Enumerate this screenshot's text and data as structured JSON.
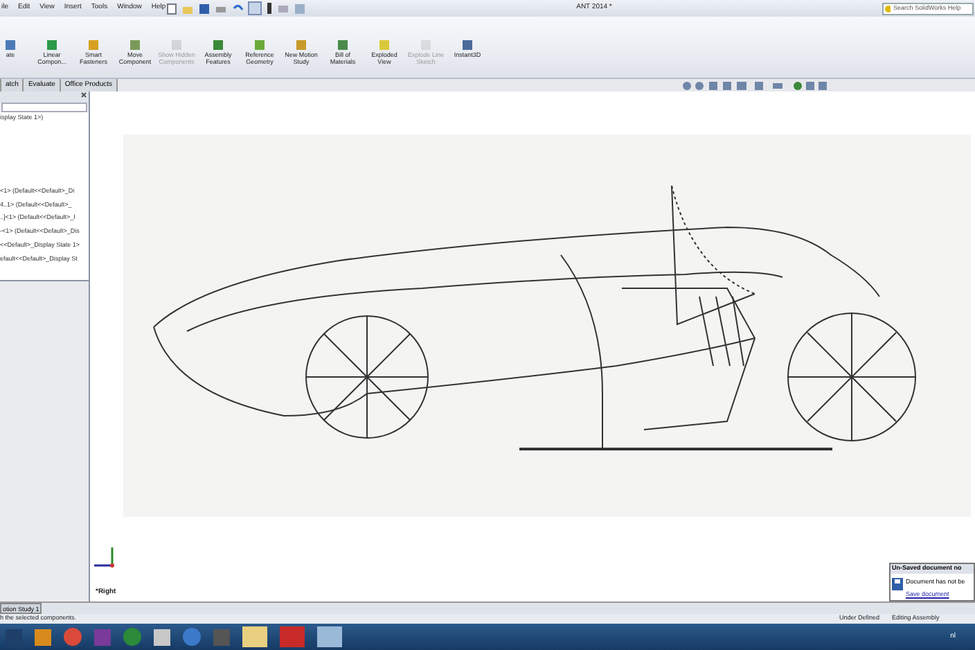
{
  "menu_bar": {
    "items": [
      "ile",
      "Edit",
      "View",
      "Insert",
      "Tools",
      "Window",
      "Help"
    ],
    "title": "ANT 2014 *",
    "search": {
      "placeholder": "Search SolidWorks Help"
    }
  },
  "ribbon": {
    "buttons": [
      {
        "label": "ate",
        "disabled": false
      },
      {
        "label": "Linear Compon...",
        "disabled": false
      },
      {
        "label": "Smart Fasteners",
        "disabled": false
      },
      {
        "label": "Move Component",
        "disabled": false
      },
      {
        "label": "Show Hidden Components",
        "disabled": true
      },
      {
        "label": "Assembly Features",
        "disabled": false
      },
      {
        "label": "Reference Geometry",
        "disabled": false
      },
      {
        "label": "New Motion Study",
        "disabled": false
      },
      {
        "label": "Bill of Materials",
        "disabled": false
      },
      {
        "label": "Exploded View",
        "disabled": false
      },
      {
        "label": "Explode Line Sketch",
        "disabled": true
      },
      {
        "label": "Instant3D",
        "disabled": false
      }
    ]
  },
  "tabs": [
    {
      "label": "atch",
      "selected": false
    },
    {
      "label": "Evaluate",
      "selected": false
    },
    {
      "label": "Office Products",
      "selected": false
    }
  ],
  "tree": {
    "top": "isplay State 1>)",
    "items": [
      "<1> (Default<<Default>_Di",
      "4..1> (Default<<Default>_",
      "..]<1> (Default<<Default>_I",
      "-<1> (Default<<Default>_Dis",
      "<<Default>_Display State 1>",
      "efault<<Default>_Display St"
    ]
  },
  "viewport": {
    "view_label": "*Right"
  },
  "bottom_tab": "otion Study 1",
  "notification": {
    "title": "Un-Saved document no",
    "message": "Document has not be",
    "link": "Save document"
  },
  "status_bar": {
    "message": "h the selected components.",
    "state": "Under Defined",
    "mode": "Editing Assembly"
  },
  "taskbar": {
    "tray_text": "nl"
  }
}
